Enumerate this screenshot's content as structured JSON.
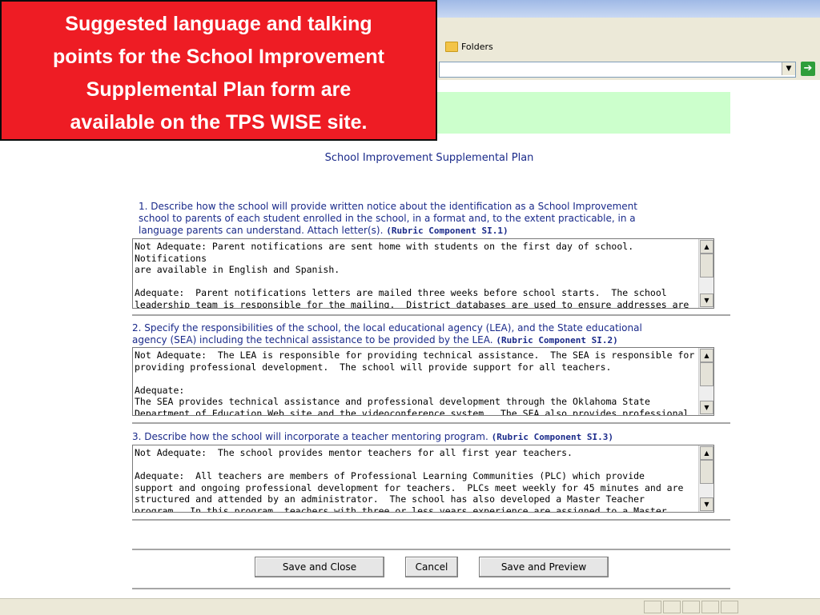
{
  "callout": {
    "lines": [
      "Suggested language and talking",
      "points  for the School Improvement",
      "Supplemental Plan form are",
      "available on the TPS WISE site."
    ]
  },
  "browser": {
    "folders_label": "Folders",
    "address_dropdown": "▼",
    "go_label": "➔"
  },
  "form": {
    "title": "School Improvement Supplemental Plan",
    "questions": [
      {
        "lines": [
          "1. Describe how the school will provide written notice about the identification as a School Improvement",
          "school to parents of each student enrolled in the school, in a format and, to the extent practicable, in a",
          "language parents can understand. Attach letter(s)."
        ],
        "rubric": "(Rubric Component SI.1)",
        "answer": "Not Adequate: Parent notifications are sent home with students on the first day of school.  Notifications\nare available in English and Spanish.\n\nAdequate:  Parent notifications letters are mailed three weeks before school starts.  The school\nleadership team is responsible for the mailing.  District databases are used to ensure addresses are\ncorrect.  All efforts are made to forward any letters that are returned.  Letters are mailed in English and"
      },
      {
        "lines": [
          "2. Specify the responsibilities of the school, the local educational agency (LEA), and the State educational",
          "agency (SEA) including the technical assistance to be provided by the LEA."
        ],
        "rubric": "(Rubric Component SI.2)",
        "answer": "Not Adequate:  The LEA is responsible for providing technical assistance.  The SEA is responsible for\nproviding professional development.  The school will provide support for all teachers.\n\nAdequate:\nThe SEA provides technical assistance and professional development through the Oklahoma State\nDepartment of Education Web site and the videoconference system.  The SEA also provides professional"
      },
      {
        "lines": [
          "3. Describe how the school will incorporate a teacher mentoring program."
        ],
        "rubric": "(Rubric Component SI.3)",
        "answer": "Not Adequate:  The school provides mentor teachers for all first year teachers.\n\nAdequate:  All teachers are members of Professional Learning Communities (PLC) which provide\nsupport and ongoing professional development for teachers.  PLCs meet weekly for 45 minutes and are\nstructured and attended by an administrator.  The school has also developed a Master Teacher\nprogram.  In this program, teachers with three or less years experience are assigned to a Master"
      }
    ],
    "buttons": {
      "save_close": "Save and Close",
      "cancel": "Cancel",
      "save_preview": "Save and Preview"
    },
    "scroll_up": "▲",
    "scroll_down": "▼"
  },
  "colors": {
    "callout_bg": "#ee1c24",
    "form_text": "#1a2a8a",
    "green_bar": "#ccffcc"
  }
}
